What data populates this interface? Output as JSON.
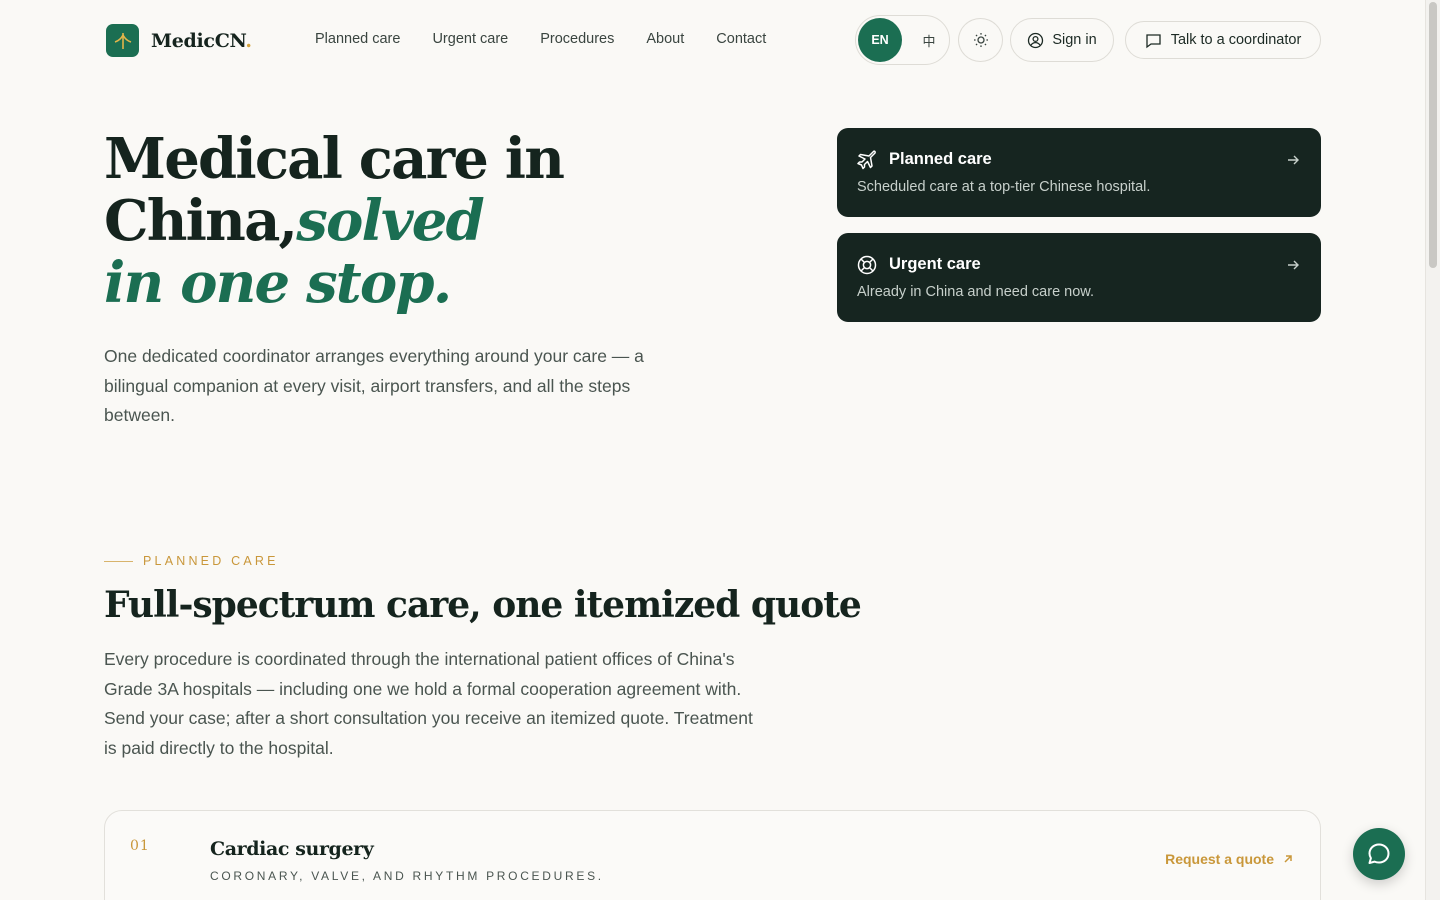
{
  "brand": {
    "name": "MedicCN",
    "dot": "."
  },
  "nav": {
    "items": [
      "Planned care",
      "Urgent care",
      "Procedures",
      "About",
      "Contact"
    ]
  },
  "header": {
    "lang_en": "EN",
    "lang_zh": "中",
    "signin_label": "Sign in",
    "coordinator_label": "Talk to a coordinator"
  },
  "hero": {
    "title_line1": "Medical care in",
    "title_line2": "China,",
    "title_accent1": "solved",
    "title_accent2": "in one stop.",
    "subtitle": "One dedicated coordinator arranges everything around your care — a bilingual companion at every visit, airport transfers, and all the steps between."
  },
  "cards": [
    {
      "title": "Planned care",
      "desc": "Scheduled care at a top-tier Chinese hospital.",
      "icon": "plane-icon"
    },
    {
      "title": "Urgent care",
      "desc": "Already in China and need care now.",
      "icon": "lifebuoy-icon"
    }
  ],
  "section": {
    "eyebrow": "PLANNED CARE",
    "title": "Full-spectrum care, one itemized quote",
    "desc": "Every procedure is coordinated through the international patient offices of China's Grade 3A hospitals — including one we hold a formal cooperation agreement with. Send your case; after a short consultation you receive an itemized quote. Treatment is paid directly to the hospital."
  },
  "procedure": {
    "number": "01",
    "title": "Cardiac surgery",
    "subtitle": "CORONARY, VALVE, AND RHYTHM PROCEDURES.",
    "cta": "Request a quote"
  },
  "colors": {
    "brand_green": "#1b6e52",
    "dark_card": "#162520",
    "gold": "#c9973a",
    "background": "#faf9f6"
  }
}
